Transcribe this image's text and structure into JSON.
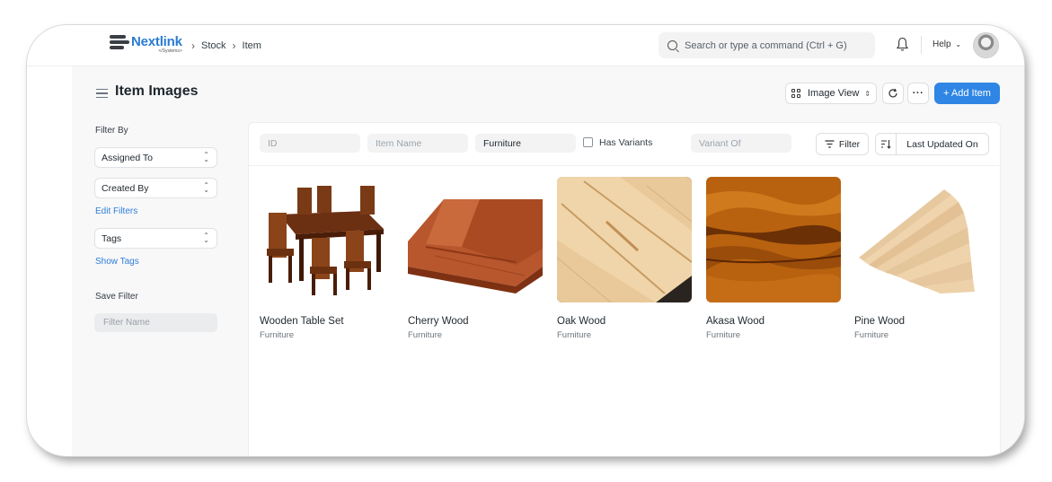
{
  "brand": {
    "name": "Nextlink",
    "sub": "</Systems>"
  },
  "breadcrumbs": [
    "Stock",
    "Item"
  ],
  "search": {
    "placeholder": "Search or type a command (Ctrl + G)"
  },
  "nav": {
    "help_label": "Help"
  },
  "page": {
    "title": "Item Images"
  },
  "toolbar": {
    "view_label": "Image View",
    "more_label": "···",
    "add_label": "+ Add Item"
  },
  "sidebar": {
    "filter_by": "Filter By",
    "assigned_to": "Assigned To",
    "created_by": "Created By",
    "edit_filters": "Edit Filters",
    "tags": "Tags",
    "show_tags": "Show Tags",
    "save_filter": "Save Filter",
    "filter_name_placeholder": "Filter Name"
  },
  "filters": {
    "id_placeholder": "ID",
    "item_name_placeholder": "Item Name",
    "item_group_value": "Furniture",
    "has_variants_label": "Has Variants",
    "variant_of_placeholder": "Variant Of",
    "filter_label": "Filter",
    "sort_label": "Last Updated On"
  },
  "items": [
    {
      "name": "Wooden Table Set",
      "category": "Furniture"
    },
    {
      "name": "Cherry Wood",
      "category": "Furniture"
    },
    {
      "name": "Oak Wood",
      "category": "Furniture"
    },
    {
      "name": "Akasa Wood",
      "category": "Furniture"
    },
    {
      "name": "Pine Wood",
      "category": "Furniture"
    }
  ],
  "colors": {
    "accent": "#2f86e4",
    "link": "#2f7ed8",
    "brand": "#2a7bd3"
  }
}
